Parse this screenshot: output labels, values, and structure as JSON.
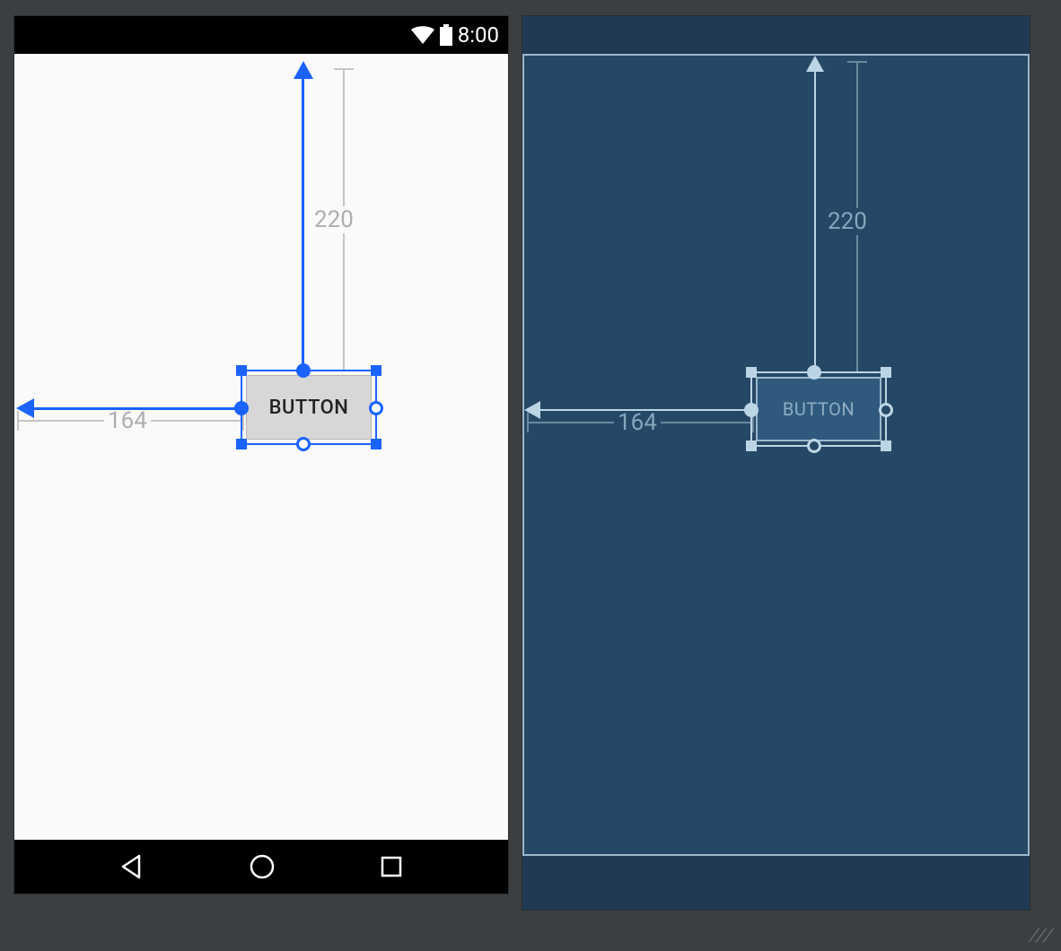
{
  "status_bar": {
    "time": "8:00",
    "wifi_icon": "wifi-icon",
    "battery_icon": "battery-icon"
  },
  "nav_bar": {
    "back_icon": "triangle-back",
    "home_icon": "circle-home",
    "recent_icon": "square-recent"
  },
  "design": {
    "button_label": "BUTTON",
    "constraint_top_value": "220",
    "constraint_left_value": "164"
  },
  "blueprint": {
    "button_label": "BUTTON",
    "constraint_top_value": "220",
    "constraint_left_value": "164"
  },
  "colors": {
    "editor_bg": "#3c3f41",
    "selection_blue": "#1a63ff",
    "blueprint_bg": "#254866",
    "blueprint_outline": "#9bb8cb"
  }
}
